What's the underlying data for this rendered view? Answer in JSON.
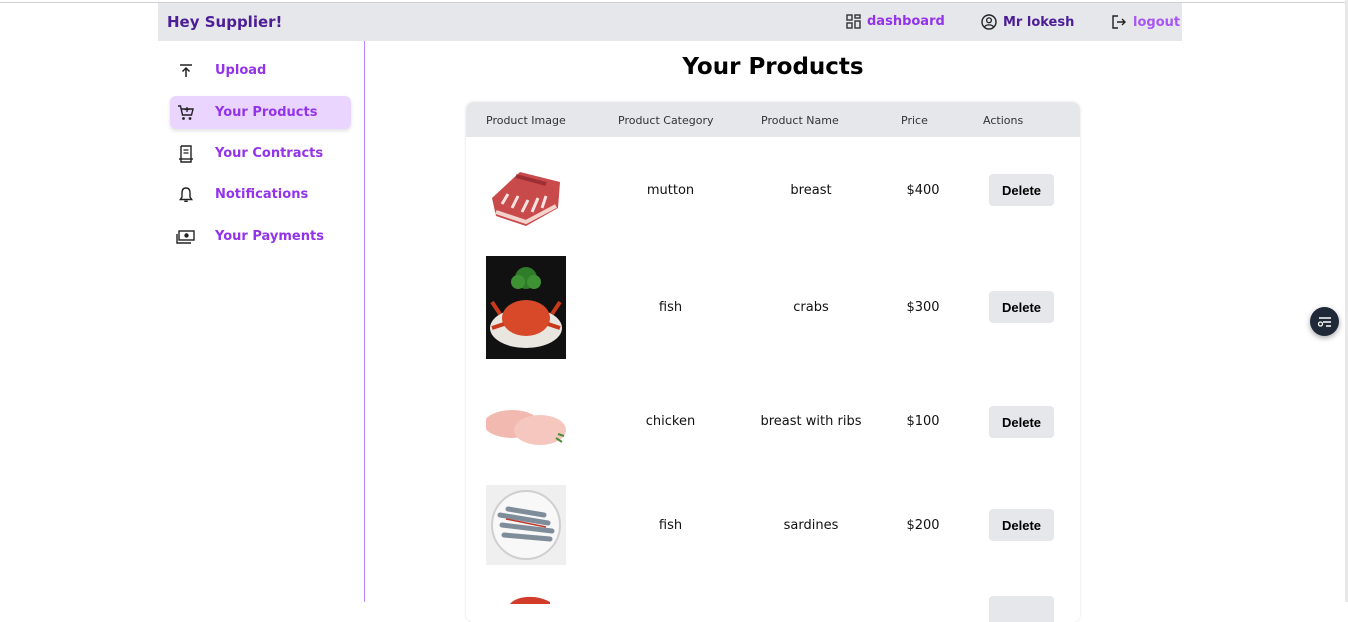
{
  "header": {
    "brand": "Hey Supplier!",
    "dashboard_label": "dashboard",
    "user_label": "Mr lokesh",
    "logout_label": "logout"
  },
  "sidebar": {
    "items": [
      {
        "label": "Upload",
        "icon": "upload-icon"
      },
      {
        "label": "Your Products",
        "icon": "cart-icon",
        "active": true
      },
      {
        "label": "Your Contracts",
        "icon": "contract-icon"
      },
      {
        "label": "Notifications",
        "icon": "bell-icon"
      },
      {
        "label": "Your Payments",
        "icon": "money-icon"
      }
    ]
  },
  "main": {
    "title": "Your Products",
    "columns": [
      "Product Image",
      "Product Category",
      "Product Name",
      "Price",
      "Actions"
    ],
    "rows": [
      {
        "category": "mutton",
        "name": "breast",
        "price": "$400",
        "action": "Delete"
      },
      {
        "category": "fish",
        "name": "crabs",
        "price": "$300",
        "action": "Delete"
      },
      {
        "category": "chicken",
        "name": "breast with ribs",
        "price": "$100",
        "action": "Delete"
      },
      {
        "category": "fish",
        "name": "sardines",
        "price": "$200",
        "action": "Delete"
      }
    ]
  },
  "colors": {
    "accent": "#9333ea",
    "brand": "#4c1d95",
    "active_bg": "#e9d5ff",
    "header_bg": "#e5e7eb"
  }
}
